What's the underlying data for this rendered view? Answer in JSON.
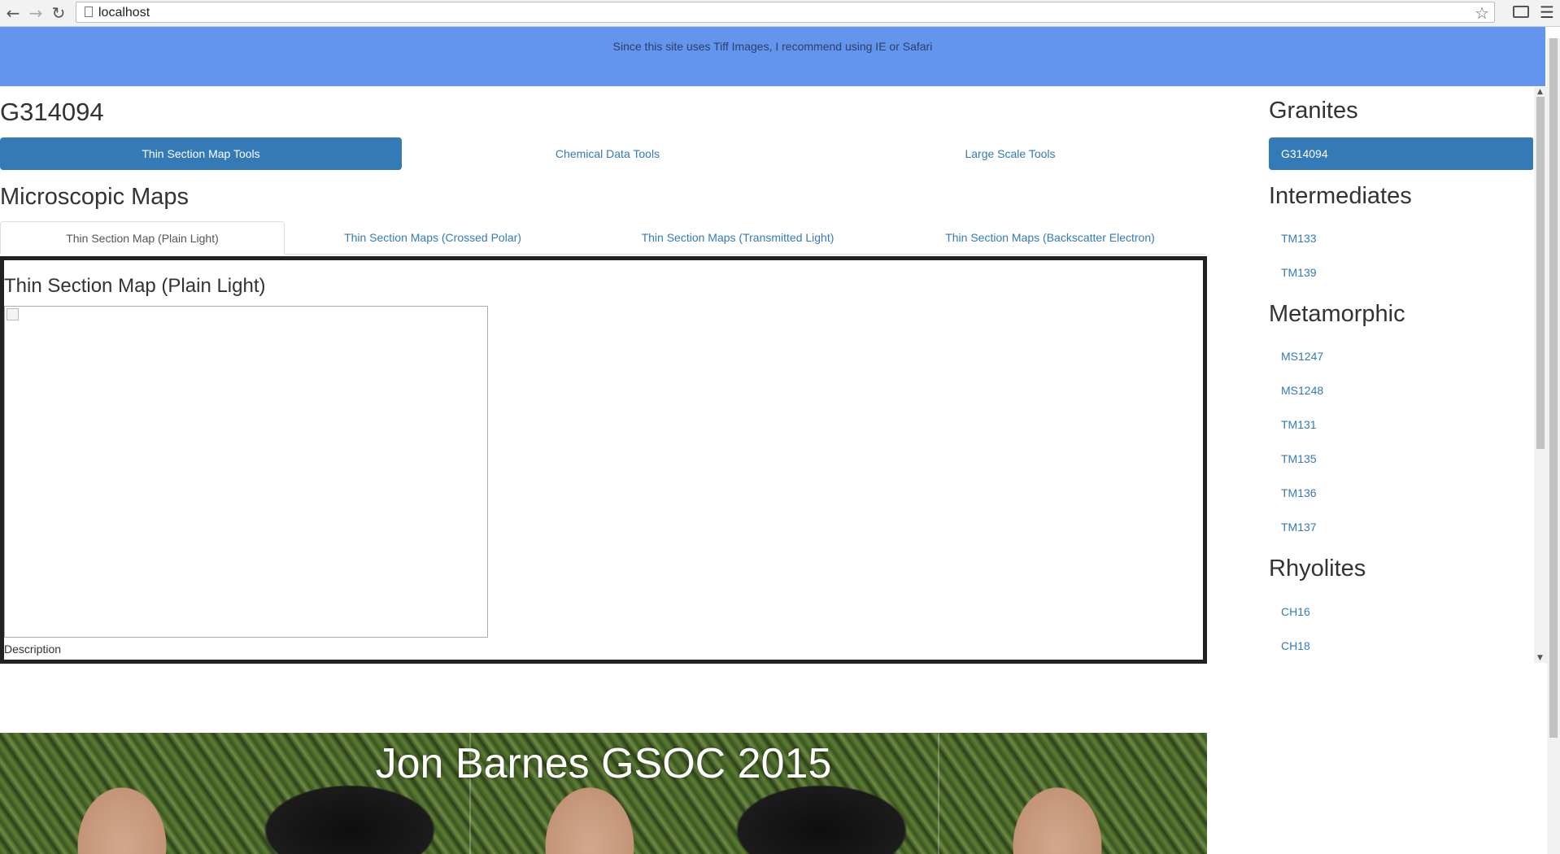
{
  "browser": {
    "url": "localhost",
    "icons": [
      "back-icon",
      "forward-icon",
      "reload-icon",
      "page-icon",
      "bookmark-star-icon",
      "cast-icon",
      "menu-icon"
    ]
  },
  "banner": {
    "note": "Since this site uses Tiff Images, I recommend using IE or Safari",
    "color": "#6495ed"
  },
  "sample": {
    "title": "G314094"
  },
  "tool_tabs": [
    {
      "label": "Thin Section Map Tools",
      "active": true
    },
    {
      "label": "Chemical Data Tools",
      "active": false
    },
    {
      "label": "Large Scale Tools",
      "active": false
    }
  ],
  "section": {
    "title": "Microscopic Maps"
  },
  "map_tabs": [
    {
      "label": "Thin Section Map (Plain Light)",
      "active": true
    },
    {
      "label": "Thin Section Maps (Crossed Polar)",
      "active": false
    },
    {
      "label": "Thin Section Maps (Transmitted Light)",
      "active": false
    },
    {
      "label": "Thin Section Maps (Backscatter Electron)",
      "active": false
    }
  ],
  "map_panel": {
    "title": "Thin Section Map (Plain Light)",
    "description": "Description"
  },
  "sidebar": {
    "groups": [
      {
        "heading": "Granites",
        "items": [
          {
            "label": "G314094",
            "active": true
          }
        ]
      },
      {
        "heading": "Intermediates",
        "items": [
          {
            "label": "TM133",
            "active": false
          },
          {
            "label": "TM139",
            "active": false
          }
        ]
      },
      {
        "heading": "Metamorphic",
        "items": [
          {
            "label": "MS1247",
            "active": false
          },
          {
            "label": "MS1248",
            "active": false
          },
          {
            "label": "TM131",
            "active": false
          },
          {
            "label": "TM135",
            "active": false
          },
          {
            "label": "TM136",
            "active": false
          },
          {
            "label": "TM137",
            "active": false
          }
        ]
      },
      {
        "heading": "Rhyolites",
        "items": [
          {
            "label": "CH16",
            "active": false
          },
          {
            "label": "CH18",
            "active": false
          }
        ]
      }
    ]
  },
  "footer": {
    "title": "Jon Barnes GSOC 2015"
  },
  "colors": {
    "accent": "#337ab7",
    "panel_border": "#222222"
  }
}
